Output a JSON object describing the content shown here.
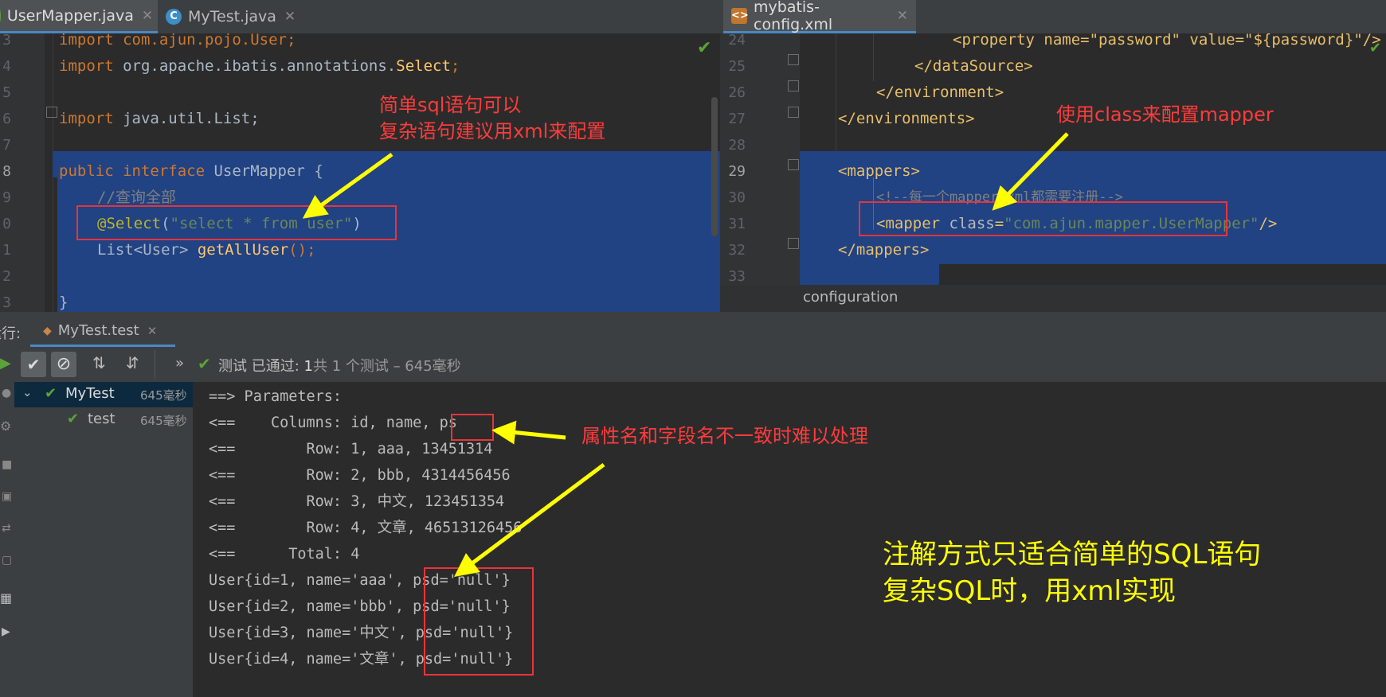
{
  "left_tabs": [
    {
      "label": "UserMapper.java",
      "active": true
    },
    {
      "label": "MyTest.java",
      "active": false
    }
  ],
  "right_tabs": [
    {
      "label": "mybatis-config.xml",
      "active": true
    }
  ],
  "left_editor": {
    "line_numbers": [
      "3",
      "4",
      "5",
      "6",
      "7",
      "8",
      "9",
      "0",
      "1",
      "2",
      "3"
    ],
    "import1": "import com.ajun.pojo.User;",
    "import2_kw": "import",
    "import2_rest": " org.apache.ibatis.annotations.",
    "import2_cls": "Select",
    "import2_end": ";",
    "import3_kw": "import",
    "import3_rest": " java.util.List;",
    "decl_kw1": "public",
    "decl_kw2": "interface",
    "decl_name": " UserMapper {",
    "comment": "//查询全部",
    "ann": "@Select",
    "ann_open": "(",
    "ann_str": "\"select * from user\"",
    "ann_close": ")",
    "method_type": "List<User> ",
    "method_name": "getAllUser",
    "method_end": "();",
    "close_brace": "}"
  },
  "right_editor": {
    "line_numbers": [
      "24",
      "25",
      "26",
      "27",
      "28",
      "29",
      "30",
      "31",
      "32",
      "33"
    ],
    "l24": "<property name=\"password\" value=\"${password}\"/>",
    "l25": "</dataSource>",
    "l26": "</environment>",
    "l27": "</environments>",
    "l29": "<mappers>",
    "l30": "<!--每一个mapper.xml都需要注册-->",
    "l31_tag": "<mapper ",
    "l31_attr": "class",
    "l31_eq": "=",
    "l31_val": "\"com.ajun.mapper.UserMapper\"",
    "l31_end": "/>",
    "l32": "</mappers>",
    "breadcrumb": "configuration"
  },
  "annotations": {
    "left_note_line1": "简单sql语句可以",
    "left_note_line2": "复杂语句建议用xml来配置",
    "right_note": "使用class来配置mapper",
    "console_note": "属性名和字段名不一致时难以处理",
    "summary_line1": "注解方式只适合简单的SQL语句",
    "summary_line2": "复杂SQL时，用xml实现"
  },
  "run_panel": {
    "label": "运行:",
    "tab": "MyTest.test",
    "status_prefix": "测试 已通过: ",
    "status_count": "1",
    "status_suffix": "共 1 个测试 – 645毫秒",
    "tree": [
      {
        "name": "MyTest",
        "time": "645毫秒"
      },
      {
        "name": "test",
        "time": "645毫秒"
      }
    ]
  },
  "console_lines": [
    "==> Parameters: ",
    "<==    Columns: id, name, ps",
    "<==        Row: 1, aaa, 13451314",
    "<==        Row: 2, bbb, 4314456456",
    "<==        Row: 3, 中文, 123451354",
    "<==        Row: 4, 文章, 46513126456",
    "<==      Total: 4",
    "User{id=1, name='aaa', psd='null'}",
    "User{id=2, name='bbb', psd='null'}",
    "User{id=3, name='中文', psd='null'}",
    "User{id=4, name='文章', psd='null'}"
  ],
  "colors": {
    "selection": "#214283",
    "annotation_red": "#ff3b3b",
    "annotation_yellow": "#ffff00",
    "pass_green": "#4caf50"
  }
}
